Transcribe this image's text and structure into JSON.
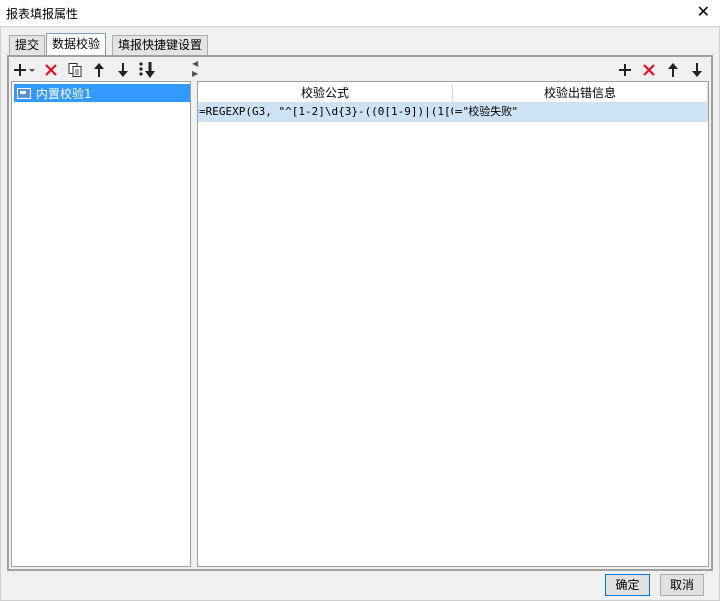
{
  "window": {
    "title": "报表填报属性",
    "close_symbol": "✕"
  },
  "tabs": [
    {
      "label": "提交",
      "active": false
    },
    {
      "label": "数据校验",
      "active": true
    },
    {
      "label": "填报快捷键设置",
      "active": false
    }
  ],
  "left_toolbar": {
    "icons": [
      "add-icon",
      "delete-icon",
      "copy-icon",
      "move-up-icon",
      "move-down-icon",
      "move-bottom-icon"
    ]
  },
  "tree": {
    "items": [
      {
        "label": "内置校验1",
        "selected": true
      }
    ]
  },
  "right_toolbar": {
    "icons": [
      "add-icon",
      "delete-icon",
      "move-up-icon",
      "move-down-icon"
    ]
  },
  "grid": {
    "headers": [
      "校验公式",
      "校验出错信息"
    ],
    "rows": [
      {
        "formula": "=REGEXP(G3, \"^[1-2]\\d{3}-((0[1-9])|(1[0...",
        "message": "=\"校验失败\"",
        "selected": true
      }
    ]
  },
  "buttons": {
    "ok": "确定",
    "cancel": "取消"
  },
  "colors": {
    "accent": "#3399ff",
    "delete": "#e81123",
    "selected_row": "#cde3f3"
  }
}
